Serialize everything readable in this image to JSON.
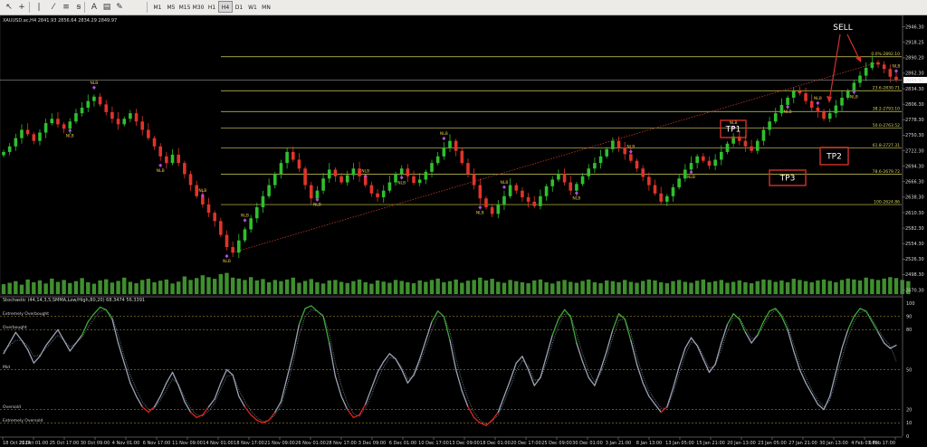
{
  "toolbar": {
    "tools": [
      {
        "name": "cursor-icon",
        "glyph": "↖"
      },
      {
        "name": "crosshair-icon",
        "glyph": "+"
      },
      {
        "name": "vertical-line-icon",
        "glyph": "|"
      },
      {
        "name": "trendline-icon",
        "glyph": "⁄"
      },
      {
        "name": "channel-icon",
        "glyph": "≡"
      },
      {
        "name": "fibonacci-icon",
        "glyph": "ꞩ"
      },
      {
        "name": "text-tool-icon",
        "glyph": "A"
      },
      {
        "name": "label-tool-icon",
        "glyph": "▤"
      },
      {
        "name": "shapes-icon",
        "glyph": "✎"
      }
    ],
    "timeframes": [
      "M1",
      "M5",
      "M15",
      "M30",
      "H1",
      "H4",
      "D1",
      "W1",
      "MN"
    ],
    "active_timeframe": "H4"
  },
  "chart_data": [
    {
      "type": "candlestick",
      "title": "XAUUSD.ac,H4  2841.93 2856.64 2834.29 2849.97",
      "current_price": "2849.97",
      "price_axis_labels": [
        "2946.30",
        "2918.25",
        "2890.20",
        "2862.30",
        "2834.30",
        "2806.30",
        "2778.30",
        "2750.30",
        "2722.30",
        "2694.30",
        "2666.30",
        "2638.30",
        "2610.30",
        "2582.30",
        "2554.30",
        "2526.30",
        "2498.30",
        "2470.30"
      ],
      "ylim": [
        2463,
        2962
      ],
      "x_axis_labels": [
        "18 Oct 2024",
        "21 Oct 01:00",
        "25 Oct 17:00",
        "30 Oct 09:00",
        "4 Nov 01:00",
        "6 Nov 17:00",
        "11 Nov 09:00",
        "14 Nov 01:00",
        "18 Nov 17:00",
        "21 Nov 09:00",
        "26 Nov 01:00",
        "28 Nov 17:00",
        "3 Dec 09:00",
        "6 Dec 01:00",
        "10 Dec 17:00",
        "13 Dec 09:00",
        "18 Dec 01:00",
        "20 Dec 17:00",
        "25 Dec 09:00",
        "30 Dec 01:00",
        "3 Jan 21:00",
        "8 Jan 13:00",
        "13 Jan 05:00",
        "15 Jan 21:00",
        "20 Jan 13:00",
        "23 Jan 05:00",
        "27 Jan 21:00",
        "30 Jan 13:00",
        "4 Feb 01:00",
        "6 Feb 17:00"
      ],
      "fib_levels": [
        {
          "label": "0.0%-2892.10",
          "price": 2892.1
        },
        {
          "label": "23.6-2830.71",
          "price": 2830.71
        },
        {
          "label": "38.2-2793.10",
          "price": 2793.1
        },
        {
          "label": "50.0-2763.52",
          "price": 2763.52
        },
        {
          "label": "61.8-2727.31",
          "price": 2727.31
        },
        {
          "label": "78.6-2679.72",
          "price": 2679.72
        },
        {
          "label": "100-2624.86",
          "price": 2624.86
        }
      ],
      "annotations": [
        "SELL",
        "TP1",
        "TP2",
        "TP3"
      ],
      "marker_label": "NLB",
      "closes": [
        2720,
        2730,
        2745,
        2760,
        2752,
        2740,
        2755,
        2772,
        2780,
        2770,
        2762,
        2775,
        2790,
        2800,
        2812,
        2820,
        2806,
        2792,
        2780,
        2770,
        2780,
        2790,
        2775,
        2760,
        2745,
        2730,
        2712,
        2700,
        2715,
        2700,
        2680,
        2660,
        2640,
        2625,
        2610,
        2595,
        2570,
        2548,
        2538,
        2560,
        2580,
        2600,
        2620,
        2640,
        2660,
        2680,
        2700,
        2720,
        2706,
        2690,
        2660,
        2636,
        2650,
        2672,
        2688,
        2676,
        2665,
        2678,
        2690,
        2676,
        2660,
        2645,
        2638,
        2650,
        2665,
        2680,
        2690,
        2676,
        2664,
        2670,
        2684,
        2700,
        2712,
        2728,
        2740,
        2722,
        2700,
        2680,
        2660,
        2636,
        2620,
        2608,
        2625,
        2640,
        2660,
        2650,
        2638,
        2630,
        2622,
        2640,
        2658,
        2670,
        2680,
        2665,
        2650,
        2662,
        2676,
        2690,
        2700,
        2712,
        2725,
        2740,
        2728,
        2716,
        2704,
        2690,
        2675,
        2660,
        2645,
        2630,
        2640,
        2656,
        2672,
        2688,
        2700,
        2712,
        2704,
        2695,
        2706,
        2720,
        2735,
        2748,
        2740,
        2730,
        2722,
        2740,
        2760,
        2775,
        2790,
        2805,
        2818,
        2830,
        2826,
        2812,
        2800,
        2792,
        2780,
        2790,
        2804,
        2818,
        2830,
        2845,
        2858,
        2872,
        2882,
        2878,
        2870,
        2856,
        2849.97
      ],
      "volumes": [
        0.42,
        0.48,
        0.55,
        0.4,
        0.62,
        0.5,
        0.58,
        0.45,
        0.66,
        0.52,
        0.6,
        0.47,
        0.55,
        0.68,
        0.5,
        0.44,
        0.58,
        0.63,
        0.49,
        0.56,
        0.7,
        0.52,
        0.46,
        0.6,
        0.65,
        0.5,
        0.57,
        0.62,
        0.45,
        0.53,
        0.75,
        0.6,
        0.68,
        0.8,
        0.72,
        0.65,
        0.85,
        0.9,
        0.7,
        0.66,
        0.6,
        0.72,
        0.58,
        0.64,
        0.5,
        0.6,
        0.55,
        0.62,
        0.7,
        0.48,
        0.56,
        0.64,
        0.5,
        0.45,
        0.58,
        0.6,
        0.52,
        0.47,
        0.55,
        0.62,
        0.5,
        0.44,
        0.58,
        0.53,
        0.48,
        0.6,
        0.56,
        0.5,
        0.46,
        0.58,
        0.52,
        0.6,
        0.66,
        0.5,
        0.55,
        0.62,
        0.48,
        0.57,
        0.6,
        0.7,
        0.58,
        0.65,
        0.52,
        0.48,
        0.6,
        0.55,
        0.5,
        0.46,
        0.58,
        0.62,
        0.5,
        0.45,
        0.55,
        0.6,
        0.52,
        0.48,
        0.56,
        0.62,
        0.5,
        0.46,
        0.58,
        0.55,
        0.5,
        0.6,
        0.52,
        0.48,
        0.56,
        0.62,
        0.58,
        0.5,
        0.46,
        0.55,
        0.6,
        0.52,
        0.48,
        0.57,
        0.62,
        0.5,
        0.55,
        0.6,
        0.48,
        0.52,
        0.58,
        0.5,
        0.46,
        0.55,
        0.62,
        0.6,
        0.52,
        0.58,
        0.5,
        0.65,
        0.6,
        0.55,
        0.5,
        0.58,
        0.62,
        0.56,
        0.5,
        0.6,
        0.66,
        0.62,
        0.58,
        0.7,
        0.64,
        0.6,
        0.66,
        0.72,
        0.68,
        0.6,
        0.55
      ]
    },
    {
      "type": "line",
      "title": "Stochastic (44,14,3,5,SMMA,Low/High,80,20) 68.3474 56.3391",
      "ylim": [
        0,
        100
      ],
      "y_axis_labels": [
        "100",
        "90",
        "80",
        "50",
        "20",
        "10",
        "0"
      ],
      "zones": [
        {
          "label": "Extremely Overbought",
          "level": 90
        },
        {
          "label": "Overbought",
          "level": 80
        },
        {
          "label": "Mid",
          "level": 50
        },
        {
          "label": "Oversold",
          "level": 20
        },
        {
          "label": "Extremely Oversold",
          "level": 10
        }
      ],
      "colors": {
        "main": "#9aa3b5",
        "overbought": "#3fa83a",
        "oversold": "#e0251c",
        "signal": "#7d8593"
      },
      "values": [
        62,
        70,
        78,
        72,
        65,
        55,
        60,
        68,
        74,
        80,
        72,
        64,
        70,
        76,
        86,
        92,
        97,
        95,
        88,
        70,
        55,
        40,
        30,
        22,
        18,
        22,
        30,
        40,
        48,
        38,
        26,
        18,
        14,
        16,
        22,
        28,
        40,
        50,
        46,
        30,
        22,
        16,
        12,
        10,
        12,
        18,
        26,
        44,
        62,
        84,
        96,
        98,
        94,
        90,
        70,
        45,
        30,
        20,
        14,
        16,
        24,
        36,
        48,
        56,
        62,
        58,
        50,
        40,
        46,
        58,
        72,
        86,
        94,
        90,
        72,
        50,
        34,
        22,
        14,
        10,
        8,
        12,
        18,
        30,
        42,
        55,
        60,
        50,
        38,
        44,
        60,
        76,
        88,
        95,
        90,
        70,
        56,
        44,
        38,
        50,
        64,
        80,
        92,
        88,
        72,
        54,
        40,
        30,
        24,
        18,
        22,
        36,
        52,
        66,
        74,
        68,
        58,
        48,
        54,
        70,
        84,
        92,
        88,
        78,
        70,
        76,
        86,
        94,
        96,
        90,
        80,
        64,
        50,
        40,
        32,
        24,
        20,
        30,
        48,
        66,
        80,
        90,
        96,
        94,
        86,
        78,
        70,
        66,
        68.35
      ],
      "signal": [
        64,
        68,
        72,
        72,
        68,
        60,
        61,
        66,
        71,
        76,
        72,
        67,
        70,
        74,
        82,
        88,
        94,
        95,
        90,
        76,
        60,
        46,
        35,
        26,
        20,
        21,
        27,
        35,
        43,
        39,
        29,
        21,
        16,
        15,
        19,
        25,
        35,
        45,
        46,
        35,
        26,
        19,
        14,
        11,
        12,
        16,
        23,
        38,
        55,
        76,
        90,
        95,
        94,
        91,
        77,
        55,
        38,
        25,
        17,
        15,
        21,
        31,
        43,
        52,
        59,
        58,
        52,
        43,
        45,
        55,
        67,
        80,
        90,
        90,
        78,
        58,
        41,
        28,
        18,
        12,
        9,
        11,
        16,
        26,
        37,
        49,
        57,
        53,
        42,
        43,
        55,
        70,
        83,
        92,
        91,
        77,
        62,
        49,
        41,
        47,
        59,
        74,
        87,
        88,
        77,
        60,
        45,
        34,
        27,
        21,
        21,
        32,
        47,
        61,
        71,
        69,
        61,
        51,
        53,
        65,
        79,
        89,
        89,
        81,
        73,
        75,
        83,
        91,
        95,
        92,
        83,
        69,
        55,
        44,
        35,
        27,
        22,
        27,
        42,
        59,
        74,
        86,
        93,
        94,
        88,
        80,
        73,
        68,
        56.34
      ]
    }
  ]
}
